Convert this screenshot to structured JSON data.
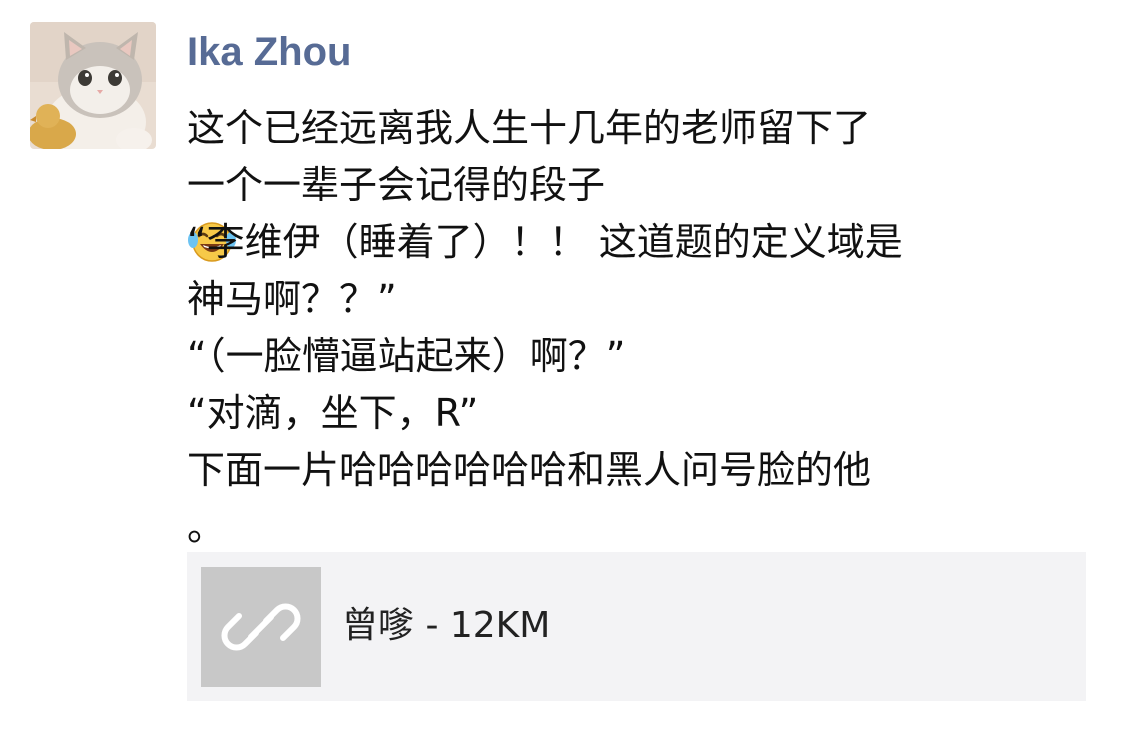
{
  "post": {
    "username": "Ika Zhou",
    "avatar_icon": "cat-avatar-photo",
    "message_lines": [
      "这个已经远离我人生十几年的老师留下了",
      "一个一辈子会记得的段子",
      "“李维伊（睡着了）！！ 这道题的定义域是",
      "神马啊？？”",
      "“（一脸懵逼站起来）啊？”",
      "“对滴，坐下，R”",
      "下面一片哈哈哈哈哈哈和黑人问号脸的他",
      "。"
    ],
    "emoji_icon": "tears-of-joy-emoji",
    "link_card": {
      "icon": "link-icon",
      "title": "曾嗲 - 12KM"
    }
  },
  "colors": {
    "username": "#576b95",
    "text": "#111111",
    "card_background": "#f3f3f5",
    "thumb_background": "#c8c8c8"
  }
}
